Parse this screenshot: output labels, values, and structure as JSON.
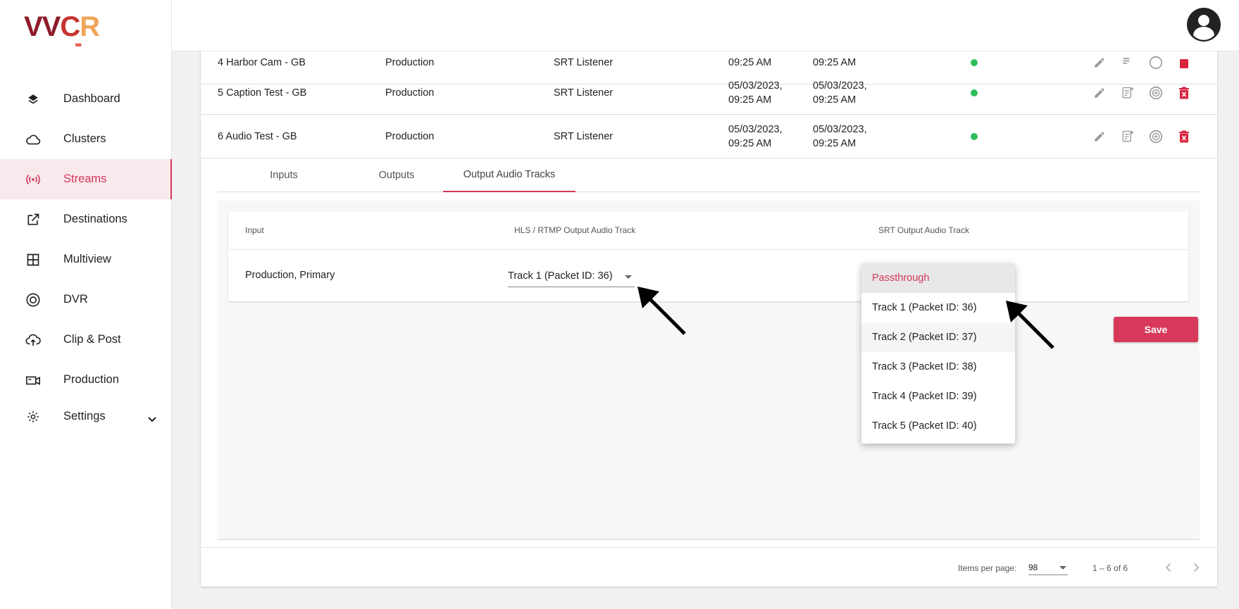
{
  "brand": {
    "logo_text": [
      "VV",
      "C",
      "R"
    ],
    "logo_chevrons": "›››››"
  },
  "sidebar": {
    "items": [
      {
        "label": "Dashboard",
        "icon": "layers-icon"
      },
      {
        "label": "Clusters",
        "icon": "cloud-icon"
      },
      {
        "label": "Streams",
        "icon": "broadcast-icon",
        "active": true
      },
      {
        "label": "Destinations",
        "icon": "external-link-icon"
      },
      {
        "label": "Multiview",
        "icon": "grid-icon"
      },
      {
        "label": "DVR",
        "icon": "record-icon"
      },
      {
        "label": "Clip & Post",
        "icon": "cloud-upload-icon"
      },
      {
        "label": "Production",
        "icon": "camera-icon"
      },
      {
        "label": "Settings",
        "icon": "gear-icon",
        "expandable": true
      }
    ]
  },
  "table": {
    "rows": [
      {
        "name": "4 Harbor Cam - GB",
        "type": "Production",
        "protocol": "SRT Listener",
        "created": [
          "",
          "09:25 AM"
        ],
        "updated": [
          "",
          "09:25 AM"
        ],
        "status": "green"
      },
      {
        "name": "5 Caption Test - GB",
        "type": "Production",
        "protocol": "SRT Listener",
        "created": [
          "05/03/2023,",
          "09:25 AM"
        ],
        "updated": [
          "05/03/2023,",
          "09:25 AM"
        ],
        "status": "green"
      },
      {
        "name": "6 Audio Test - GB",
        "type": "Production",
        "protocol": "SRT Listener",
        "created": [
          "05/03/2023,",
          "09:25 AM"
        ],
        "updated": [
          "05/03/2023,",
          "09:25 AM"
        ],
        "status": "green"
      }
    ]
  },
  "tabs": [
    "Inputs",
    "Outputs",
    "Output Audio Tracks"
  ],
  "active_tab": "Output Audio Tracks",
  "audio_tracks": {
    "headers": {
      "input": "Input",
      "hls": "HLS / RTMP Output Audio Track",
      "srt": "SRT Output Audio Track"
    },
    "row": {
      "input": "Production, Primary",
      "hls_value": "Track 1 (Packet ID: 36)"
    },
    "save_label": "Save"
  },
  "srt_dropdown": {
    "options": [
      "Passthrough",
      "Track 1 (Packet ID: 36)",
      "Track 2 (Packet ID: 37)",
      "Track 3 (Packet ID: 38)",
      "Track 4 (Packet ID: 39)",
      "Track 5 (Packet ID: 40)"
    ],
    "selected": "Passthrough"
  },
  "pagination": {
    "items_per_page_label": "Items per page:",
    "items_per_page": "98",
    "range": "1 – 6 of 6"
  },
  "colors": {
    "accent": "#d4375a",
    "status_ok": "#2ebd5b",
    "delete": "#d8263f"
  }
}
